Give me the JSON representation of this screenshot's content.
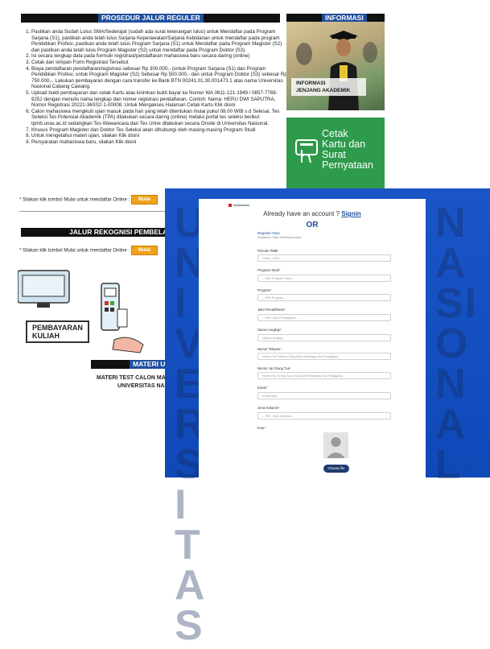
{
  "prosedur": {
    "title": "PROSEDUR JALUR REGULER",
    "steps": [
      "Pastikan anda Sudah Lulus SMA/Sederajat (sudah ada surat keterangan lulus) untuk Mendaftar pada Program Sarjana (S1), pastikan anda telah lulus Sarjana Keperawatan/Sarjana Kebidanan untuk mendaftar pada program Pendidikan Profesi, pastikan anda telah lulus Program Sarjana (S1) untuk Mendaftar pada Program Magister (S2) dan pastikan anda telah lulus Program Magister (S2) untuk mendaftar pada Program Doktor (S3).",
      "Isi secara lengkap data pada formulir registrasi/pendaftaran mahasiswa baru secara daring (online)",
      "Cetak dan simpan Form Registrasi Tersebut",
      "Biaya pendaftaran pendaftaran/registrasi sebesar Rp 300.000,- (untuk Program Sarjana (S1) dan Program Pendidikan Profesi, untuk Program Magister (S2) Sebesar Rp 500.000,- dan untuk Program Doktor (S3) sebesar Rp 750.000,-. Lakukan pembayaran dengan cara transfer ke Bank BTN 00241.01.30.001473.1 atas nama Universitas Nasional Cabang Cawang.",
      "Upload bukti pembayaran dan cetak Kartu atau kirimkan bukti bayar ke Nomer WA 0811-121-1949 / 0857-7769-9252 dengan menulis nama lengkap dan nomer registrasi pendaftaran. Contoh: Nama: HERU DWI SAPUTRA, Nomor Registrasi 20221-36SS2-1-00008. Untuk Mengakses Halaman Cetak Kartu Klik disini",
      "Calon mahasiswa mengikuti ujian masuk pada hari yang telah ditentukan mulai pukul 08.00 WIB s.d Selesai. Tes Seleksi Tes Potensial Akademik (TPA) dilakukan secara daring (online) melalui portal tes seleksi berikut: tpmb.unas.ac.id sedangkan Tes Wawancara dan Tes Urine dilakukan secara Onsite di Universitas Nasional.",
      "Khusus Program Magister dan Doktor Tes Seleksi akan dihubungi oleh masing-masing Program Studi",
      "Untuk mengetahui materi ujian, silakan Klik disini",
      "Persyaratan mahasiswa baru, silakan Klik disini"
    ],
    "note": "* Silakan klik tombol Mulai untuk mendaftar Online :",
    "mulai_label": "Mulai"
  },
  "informasi": {
    "title": "INFORMASI",
    "caption_line1": "INFORMASI",
    "caption_line2": "JENJANG AKADEMIK",
    "cetak_line1": "Cetak",
    "cetak_line2": "Kartu dan",
    "cetak_line3": "Surat",
    "cetak_line4": "Pernyataan"
  },
  "rekognisi": {
    "title": "JALUR REKOGNISI PEMBELAJA",
    "note": "* Silakan klik tombol Mulai untuk mendaftar Online :",
    "mulai_label": "Mulai",
    "pay_line1": "PEMBAYARAN",
    "pay_line2": "KULIAH"
  },
  "materi": {
    "title": "MATERI UJIA",
    "line1": "MATERI TEST CALON MAHA",
    "line2": "UNIVERSITAS NASI"
  },
  "register_form": {
    "already": "Already have an account ?",
    "signin": "Signin",
    "or": "OR",
    "register_now": "Register Now",
    "register_sub": "Registrasi Online Mahasiswa Baru",
    "fields": [
      {
        "label": "Periode PMB",
        "value": "Ganjil - 2023"
      },
      {
        "label": "Program Studi",
        "value": "-- Pilih Program Studi --"
      },
      {
        "label": "Program",
        "value": "-- Pilih Program --"
      },
      {
        "label": "Jalur Pendaftaran",
        "value": "-- Pilih Jalur Pendaftaran --"
      },
      {
        "label": "Nama Lengkap",
        "value": "Nama Lengkap"
      },
      {
        "label": "Nomor Telepon",
        "value": "Nomor Hp Pribadi (Yang Aktif Whatsapp dan Panggilan)"
      },
      {
        "label": "Nomor Hp Orang Tua",
        "value": "Nomor Hp Orang Tua (Yang Aktif Whatsapp dan Panggilan)"
      },
      {
        "label": "Email",
        "value": "Email Aktif"
      },
      {
        "label": "Jenis Kelamin",
        "value": "-- Pilih Jenis Kelamin --"
      },
      {
        "label": "Foto",
        "value": ""
      }
    ],
    "choose_file": "Choose file"
  },
  "bg_letters": {
    "col1": "UNIVERSITAS",
    "col2": "NASIONAL"
  }
}
